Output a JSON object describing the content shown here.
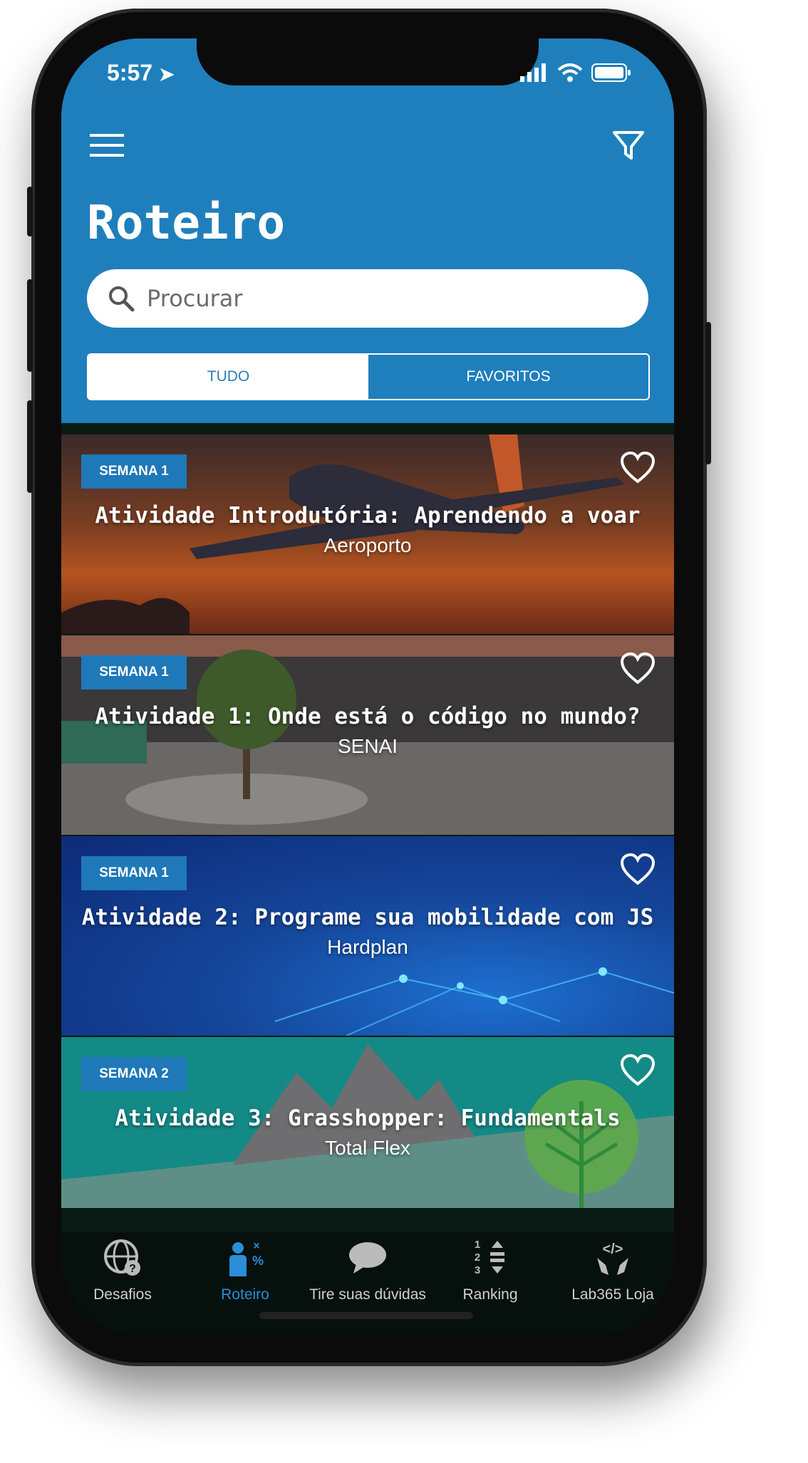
{
  "status": {
    "time": "5:57"
  },
  "header": {
    "title": "Roteiro"
  },
  "search": {
    "placeholder": "Procurar"
  },
  "segments": {
    "all": "TUDO",
    "favorites": "FAVORITOS"
  },
  "cards": [
    {
      "badge": "SEMANA 1",
      "title": "Atividade Introdutória: Aprendendo a voar",
      "subtitle": "Aeroporto"
    },
    {
      "badge": "SEMANA 1",
      "title": "Atividade 1: Onde está o código no mundo?",
      "subtitle": "SENAI"
    },
    {
      "badge": "SEMANA 1",
      "title": "Atividade 2: Programe sua mobilidade com JS",
      "subtitle": "Hardplan"
    },
    {
      "badge": "SEMANA 2",
      "title": "Atividade 3: Grasshopper: Fundamentals",
      "subtitle": "Total Flex"
    }
  ],
  "tabbar": [
    {
      "label": "Desafios",
      "icon": "globe-question-icon"
    },
    {
      "label": "Roteiro",
      "icon": "person-math-icon"
    },
    {
      "label": "Tire suas dúvidas",
      "icon": "chat-bubble-icon"
    },
    {
      "label": "Ranking",
      "icon": "ranking-icon"
    },
    {
      "label": "Lab365 Loja",
      "icon": "code-hands-icon"
    }
  ],
  "colors": {
    "primary": "#1f7fbc",
    "active_tab": "#2a8fd6",
    "tabbar_bg": "#06100c"
  }
}
